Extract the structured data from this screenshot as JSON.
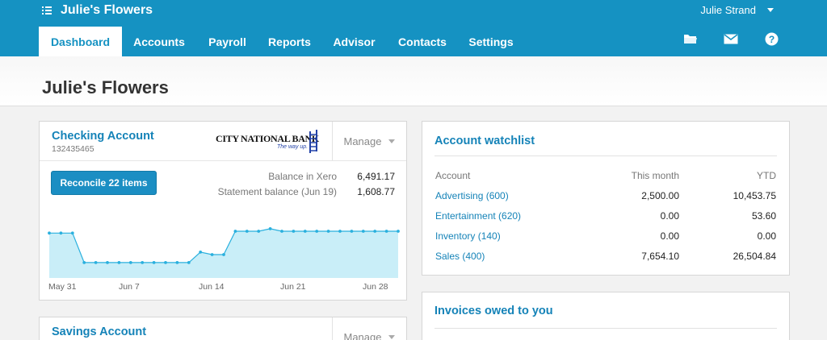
{
  "topbar": {
    "org_name": "Julie's Flowers",
    "user_name": "Julie Strand",
    "tabs": [
      "Dashboard",
      "Accounts",
      "Payroll",
      "Reports",
      "Advisor",
      "Contacts",
      "Settings"
    ],
    "active_tab": "Dashboard",
    "icons": [
      "folder-icon",
      "mail-icon",
      "help-icon"
    ]
  },
  "page": {
    "title": "Julie's Flowers"
  },
  "checking": {
    "title": "Checking Account",
    "number": "132435465",
    "bank_logo_text": "CITY NATIONAL BANK",
    "bank_tagline": "The way up.",
    "manage_label": "Manage",
    "reconcile_label": "Reconcile 22 items",
    "balance_xero_label": "Balance in Xero",
    "balance_xero_value": "6,491.17",
    "statement_label": "Statement balance (Jun 19)",
    "statement_value": "1,608.77",
    "x_labels": [
      "May 31",
      "Jun 7",
      "Jun 14",
      "Jun 21",
      "Jun 28"
    ]
  },
  "chart_data": {
    "type": "area",
    "x": [
      "May 31",
      "Jun 1",
      "Jun 2",
      "Jun 3",
      "Jun 4",
      "Jun 5",
      "Jun 6",
      "Jun 7",
      "Jun 8",
      "Jun 9",
      "Jun 10",
      "Jun 11",
      "Jun 12",
      "Jun 13",
      "Jun 14",
      "Jun 15",
      "Jun 16",
      "Jun 17",
      "Jun 18",
      "Jun 19",
      "Jun 20",
      "Jun 21",
      "Jun 22",
      "Jun 23",
      "Jun 24",
      "Jun 25",
      "Jun 26",
      "Jun 27",
      "Jun 28",
      "Jun 29",
      "Jun 30"
    ],
    "values": [
      73,
      73,
      73,
      25,
      25,
      25,
      25,
      25,
      25,
      25,
      25,
      25,
      25,
      42,
      38,
      38,
      76,
      76,
      76,
      80,
      76,
      76,
      76,
      76,
      76,
      76,
      76,
      76,
      76,
      76,
      76
    ],
    "ylim": [
      0,
      110
    ],
    "color": "#c9eef8",
    "line_color": "#2ab0de"
  },
  "savings": {
    "title": "Savings Account",
    "manage_label": "Manage"
  },
  "watchlist": {
    "title": "Account watchlist",
    "headers": [
      "Account",
      "This month",
      "YTD"
    ],
    "rows": [
      {
        "account": "Advertising (600)",
        "month": "2,500.00",
        "ytd": "10,453.75"
      },
      {
        "account": "Entertainment (620)",
        "month": "0.00",
        "ytd": "53.60"
      },
      {
        "account": "Inventory (140)",
        "month": "0.00",
        "ytd": "0.00"
      },
      {
        "account": "Sales (400)",
        "month": "7,654.10",
        "ytd": "26,504.84"
      }
    ]
  },
  "invoices": {
    "title": "Invoices owed to you"
  }
}
